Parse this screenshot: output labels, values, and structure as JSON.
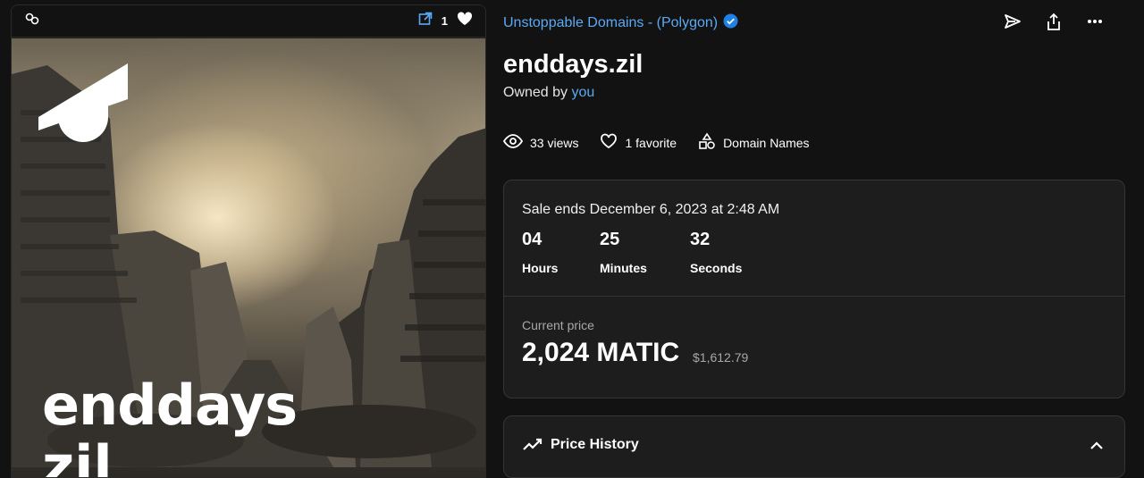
{
  "left_card": {
    "favorite_count": "1",
    "art_title_line1": "enddays",
    "art_title_line2": "zil"
  },
  "collection": {
    "name": "Unstoppable Domains - (Polygon)"
  },
  "item": {
    "title": "enddays.zil",
    "owned_prefix": "Owned by",
    "owner": "you"
  },
  "stats": {
    "views": "33 views",
    "favorites": "1 favorite",
    "category": "Domain Names"
  },
  "sale": {
    "ends_text": "Sale ends December 6, 2023 at 2:48 AM",
    "hours": "04",
    "minutes": "25",
    "seconds": "32",
    "hours_label": "Hours",
    "minutes_label": "Minutes",
    "seconds_label": "Seconds",
    "current_price_label": "Current price",
    "price": "2,024 MATIC",
    "price_usd": "$1,612.79"
  },
  "price_history": {
    "label": "Price History"
  },
  "colors": {
    "link": "#5aa9f5",
    "verified": "#2081e2",
    "background": "#121212",
    "panel": "#1d1d1d"
  }
}
